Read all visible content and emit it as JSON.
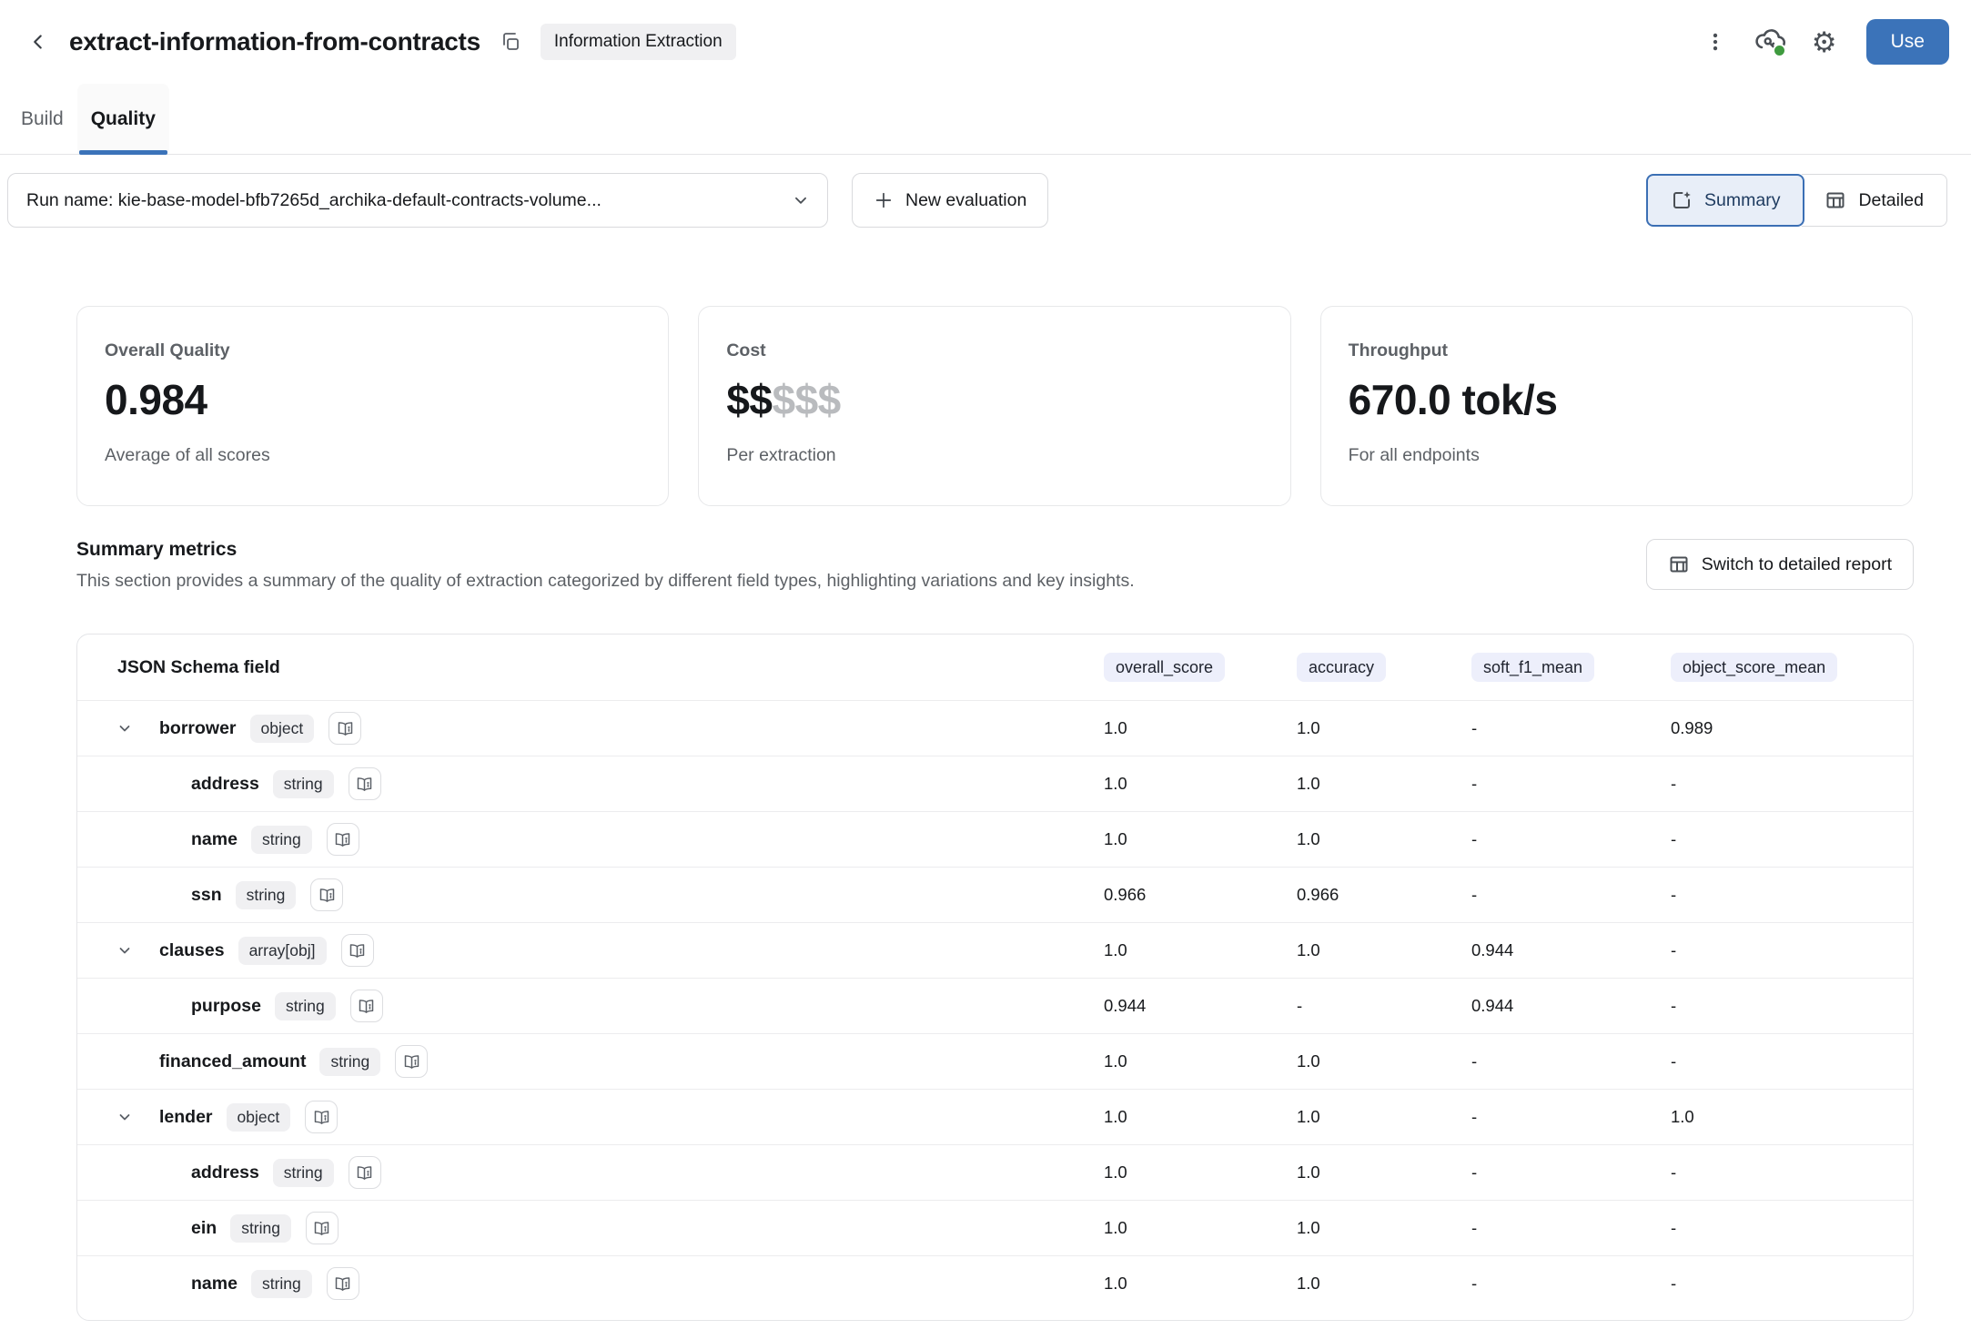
{
  "header": {
    "title": "extract-information-from-contracts",
    "badge": "Information Extraction",
    "use_label": "Use",
    "icons": [
      "back-chevron-icon",
      "copy-icon",
      "kebab-menu-icon",
      "cloud-key-status-icon",
      "gear-icon"
    ]
  },
  "tabs": [
    {
      "label": "Build",
      "active": false
    },
    {
      "label": "Quality",
      "active": true
    }
  ],
  "toolbar": {
    "run_selector": {
      "value": "Run name: kie-base-model-bfb7265d_archika-default-contracts-volume...",
      "icon": "chevron-down-icon"
    },
    "new_evaluation_label": "New evaluation",
    "view_toggle": {
      "summary_label": "Summary",
      "detailed_label": "Detailed",
      "selected": "Summary",
      "icons": [
        "summary-sparkle-frame-icon",
        "table-grid-icon"
      ]
    }
  },
  "cards": [
    {
      "label": "Overall Quality",
      "value": "0.984",
      "sub": "Average of all scores"
    },
    {
      "label": "Cost",
      "value_dark": "$$",
      "value_light": "$$$",
      "sub": "Per extraction"
    },
    {
      "label": "Throughput",
      "value": "670.0 tok/s",
      "sub": "For all endpoints"
    }
  ],
  "summary_section": {
    "title": "Summary metrics",
    "description": "This section provides a summary of the quality of extraction categorized by different field types, highlighting variations and key insights.",
    "switch_label": "Switch to detailed report",
    "switch_icon": "table-grid-icon"
  },
  "table": {
    "field_header": "JSON Schema field",
    "metric_headers": [
      "overall_score",
      "accuracy",
      "soft_f1_mean",
      "object_score_mean"
    ],
    "row_icons": {
      "expand": "chevron-down-icon",
      "info": "book-info-icon"
    },
    "rows": [
      {
        "name": "borrower",
        "type": "object",
        "level": 0,
        "expandable": true,
        "values": [
          "1.0",
          "1.0",
          "-",
          "0.989"
        ]
      },
      {
        "name": "address",
        "type": "string",
        "level": 1,
        "expandable": false,
        "values": [
          "1.0",
          "1.0",
          "-",
          "-"
        ]
      },
      {
        "name": "name",
        "type": "string",
        "level": 1,
        "expandable": false,
        "values": [
          "1.0",
          "1.0",
          "-",
          "-"
        ]
      },
      {
        "name": "ssn",
        "type": "string",
        "level": 1,
        "expandable": false,
        "values": [
          "0.966",
          "0.966",
          "-",
          "-"
        ]
      },
      {
        "name": "clauses",
        "type": "array[obj]",
        "level": 0,
        "expandable": true,
        "values": [
          "1.0",
          "1.0",
          "0.944",
          "-"
        ]
      },
      {
        "name": "purpose",
        "type": "string",
        "level": 1,
        "expandable": false,
        "values": [
          "0.944",
          "-",
          "0.944",
          "-"
        ]
      },
      {
        "name": "financed_amount",
        "type": "string",
        "level": 0,
        "expandable": false,
        "values": [
          "1.0",
          "1.0",
          "-",
          "-"
        ]
      },
      {
        "name": "lender",
        "type": "object",
        "level": 0,
        "expandable": true,
        "values": [
          "1.0",
          "1.0",
          "-",
          "1.0"
        ]
      },
      {
        "name": "address",
        "type": "string",
        "level": 1,
        "expandable": false,
        "values": [
          "1.0",
          "1.0",
          "-",
          "-"
        ]
      },
      {
        "name": "ein",
        "type": "string",
        "level": 1,
        "expandable": false,
        "values": [
          "1.0",
          "1.0",
          "-",
          "-"
        ]
      },
      {
        "name": "name",
        "type": "string",
        "level": 1,
        "expandable": false,
        "values": [
          "1.0",
          "1.0",
          "-",
          "-"
        ]
      }
    ]
  },
  "colors": {
    "accent": "#3b73b9",
    "accent_dark": "#1d3a5f",
    "status_green": "#3f9b3f",
    "selected_bg": "#e8eef8",
    "header_badge_bg": "#edeffb",
    "type_badge_bg": "#f0f0f2"
  }
}
